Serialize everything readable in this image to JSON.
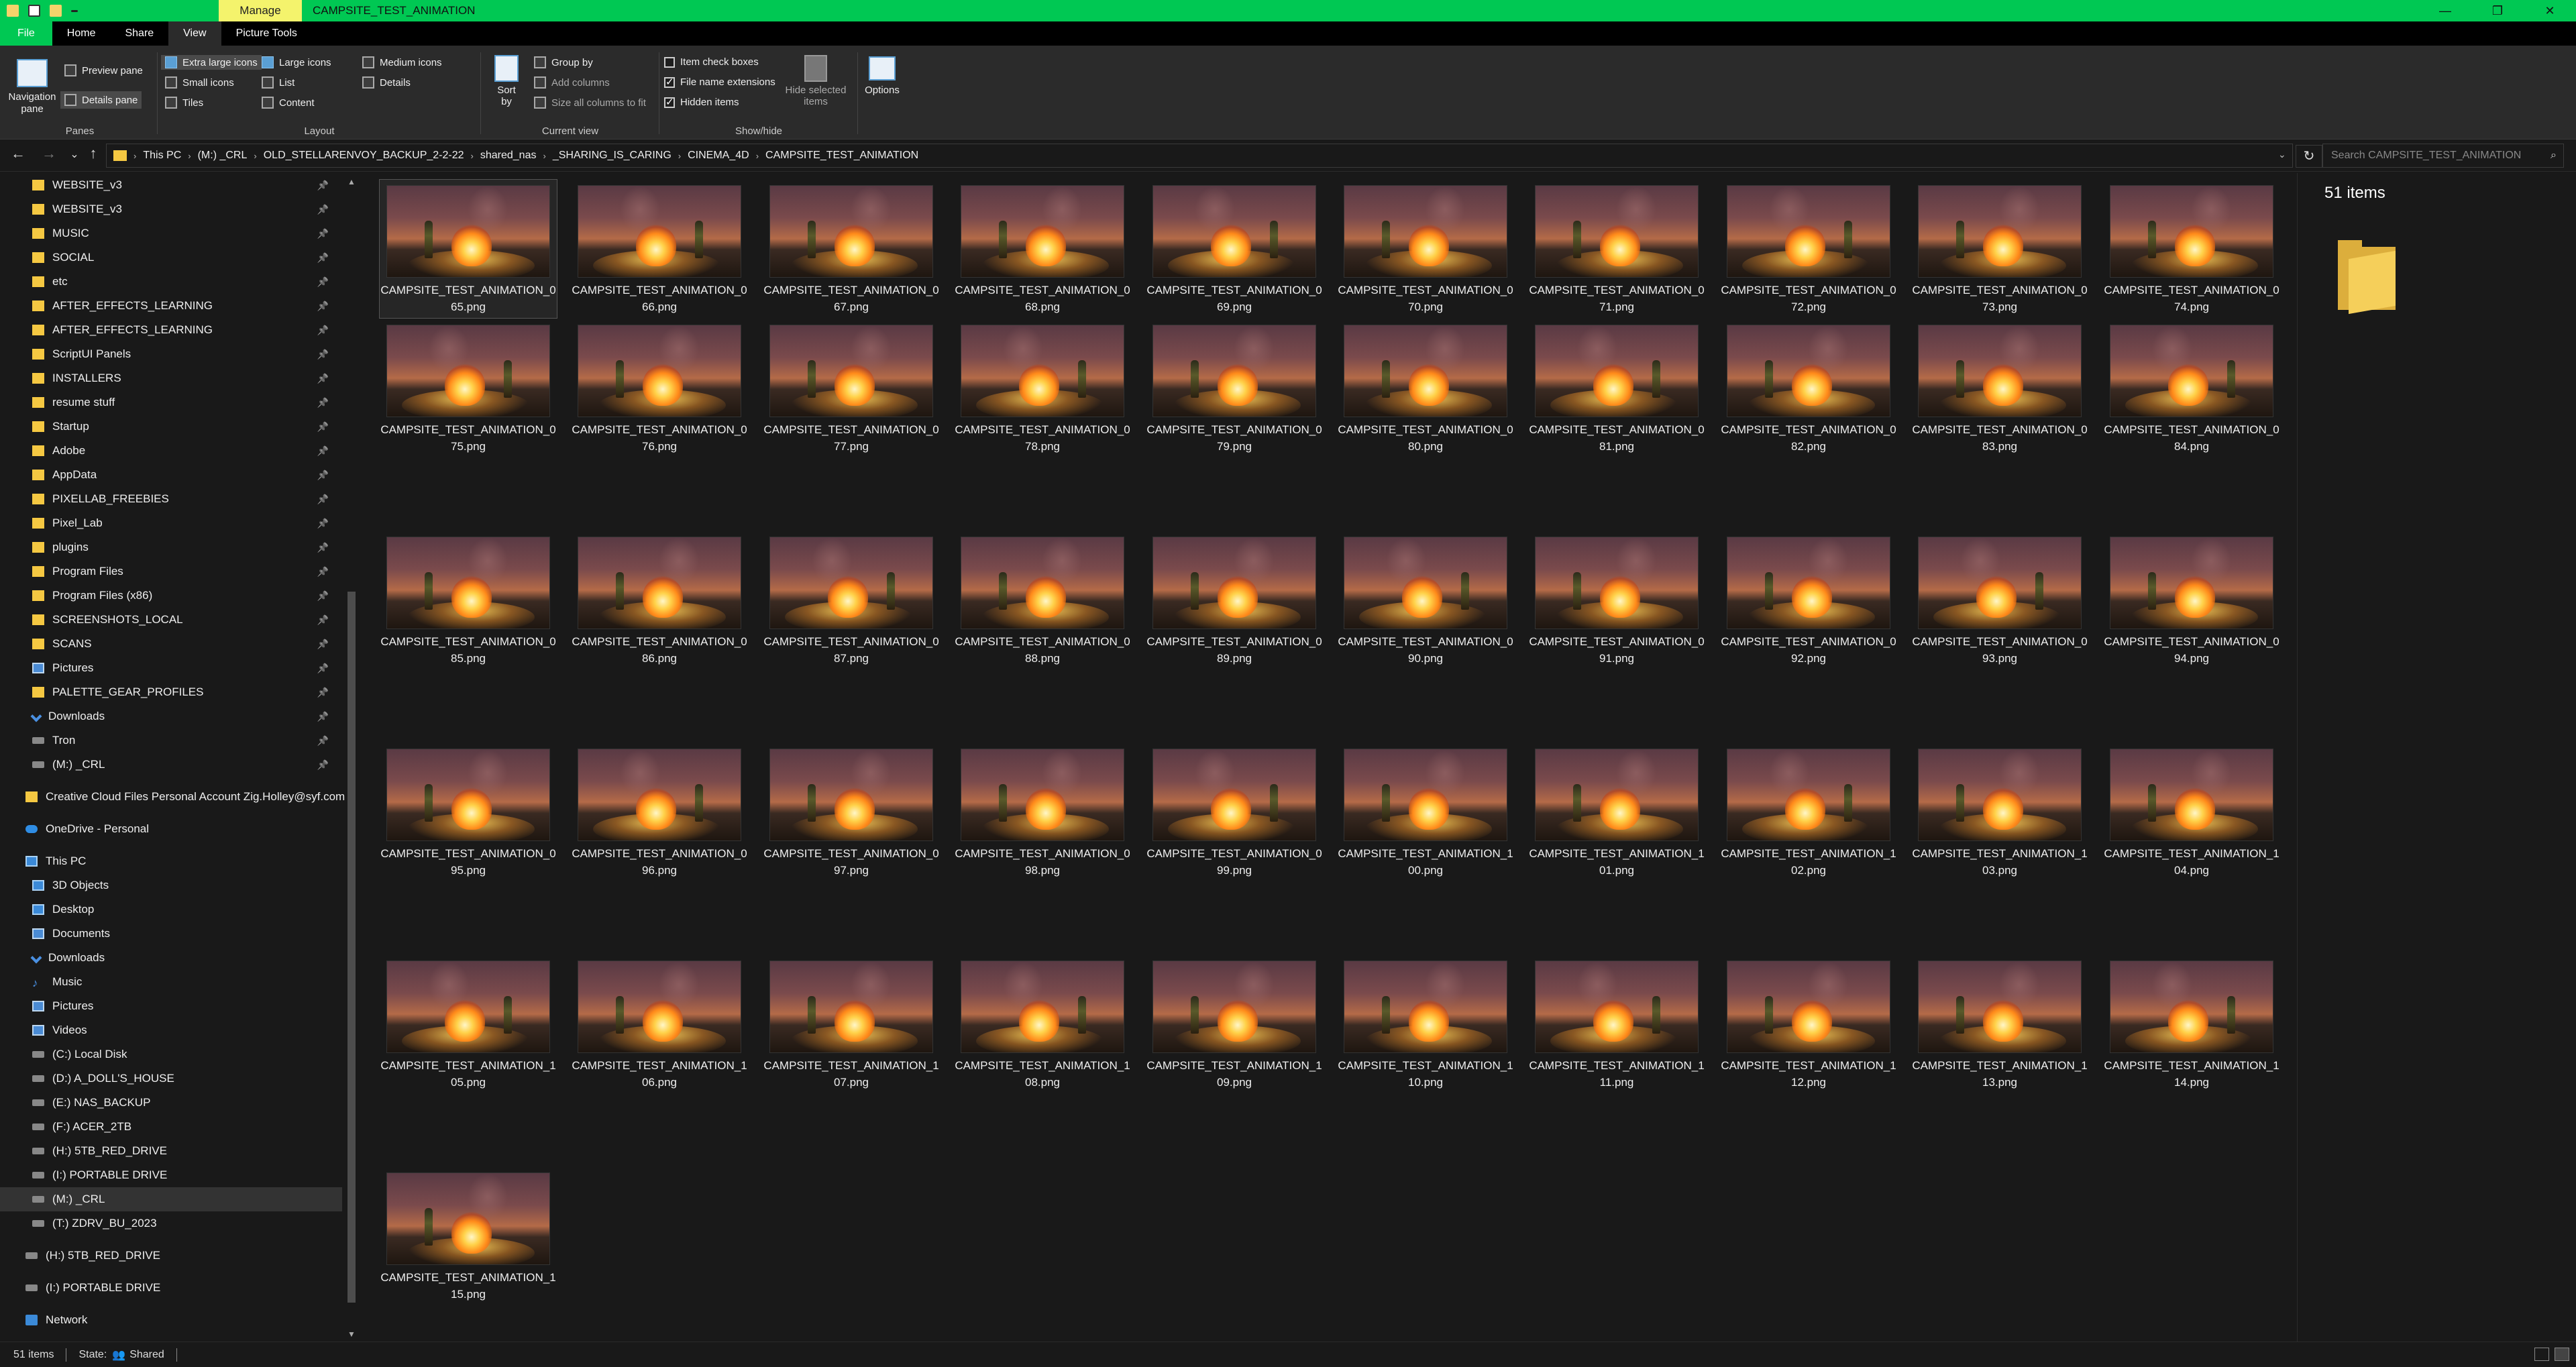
{
  "window": {
    "title": "CAMPSITE_TEST_ANIMATION",
    "context_tab": "Manage",
    "controls": [
      "—",
      "❐",
      "✕"
    ]
  },
  "ribbon_tabs": [
    "File",
    "Home",
    "Share",
    "View",
    "Picture Tools"
  ],
  "ribbon": {
    "panes": {
      "label": "Panes",
      "navigation_pane": "Navigation pane",
      "preview_pane": "Preview pane",
      "details_pane": "Details pane"
    },
    "layout": {
      "label": "Layout",
      "extra_large": "Extra large icons",
      "large": "Large icons",
      "medium": "Medium icons",
      "small": "Small icons",
      "list": "List",
      "details": "Details",
      "tiles": "Tiles",
      "content": "Content"
    },
    "current_view": {
      "label": "Current view",
      "sort_by": "Sort by",
      "group_by": "Group by",
      "add_columns": "Add columns",
      "size_columns": "Size all columns to fit"
    },
    "show_hide": {
      "label": "Show/hide",
      "item_check_boxes": "Item check boxes",
      "file_name_extensions": "File name extensions",
      "hidden_items": "Hidden items",
      "hide_selected": "Hide selected items",
      "checks": {
        "item_check_boxes": false,
        "file_name_extensions": true,
        "hidden_items": true
      }
    },
    "options": "Options"
  },
  "address": {
    "crumbs": [
      "This PC",
      "(M:) _CRL",
      "OLD_STELLARENVOY_BACKUP_2-2-22",
      "shared_nas",
      "_SHARING_IS_CARING",
      "CINEMA_4D",
      "CAMPSITE_TEST_ANIMATION"
    ],
    "search_placeholder": "Search CAMPSITE_TEST_ANIMATION"
  },
  "nav": {
    "quick_access": [
      {
        "label": "WEBSITE_v3",
        "icon": "folder",
        "pinned": true
      },
      {
        "label": "WEBSITE_v3",
        "icon": "folder",
        "pinned": true
      },
      {
        "label": "MUSIC",
        "icon": "folder",
        "pinned": true
      },
      {
        "label": "SOCIAL",
        "icon": "folder",
        "pinned": true
      },
      {
        "label": "etc",
        "icon": "folder",
        "pinned": true
      },
      {
        "label": "AFTER_EFFECTS_LEARNING",
        "icon": "folder",
        "pinned": true
      },
      {
        "label": "AFTER_EFFECTS_LEARNING",
        "icon": "folder",
        "pinned": true
      },
      {
        "label": "ScriptUI Panels",
        "icon": "folder",
        "pinned": true
      },
      {
        "label": "INSTALLERS",
        "icon": "folder",
        "pinned": true
      },
      {
        "label": "resume stuff",
        "icon": "folder",
        "pinned": true
      },
      {
        "label": "Startup",
        "icon": "folder",
        "pinned": true
      },
      {
        "label": "Adobe",
        "icon": "folder",
        "pinned": true
      },
      {
        "label": "AppData",
        "icon": "folder",
        "pinned": true
      },
      {
        "label": "PIXELLAB_FREEBIES",
        "icon": "folder",
        "pinned": true
      },
      {
        "label": "Pixel_Lab",
        "icon": "folder",
        "pinned": true
      },
      {
        "label": "plugins",
        "icon": "folder",
        "pinned": true
      },
      {
        "label": "Program Files",
        "icon": "folder",
        "pinned": true
      },
      {
        "label": "Program Files (x86)",
        "icon": "folder",
        "pinned": true
      },
      {
        "label": "SCREENSHOTS_LOCAL",
        "icon": "folder",
        "pinned": true
      },
      {
        "label": "SCANS",
        "icon": "folder",
        "pinned": true
      },
      {
        "label": "Pictures",
        "icon": "pic",
        "pinned": true
      },
      {
        "label": "PALETTE_GEAR_PROFILES",
        "icon": "folder",
        "pinned": true
      },
      {
        "label": "Downloads",
        "icon": "dl",
        "pinned": true
      },
      {
        "label": "Tron",
        "icon": "drive",
        "pinned": true
      },
      {
        "label": "(M:) _CRL",
        "icon": "drive",
        "pinned": true
      }
    ],
    "creative_cloud": "Creative Cloud Files Personal Account Zig.Holley@syf.com",
    "onedrive": "OneDrive - Personal",
    "this_pc": "This PC",
    "pc_items": [
      {
        "label": "3D Objects",
        "icon": "pc"
      },
      {
        "label": "Desktop",
        "icon": "pc"
      },
      {
        "label": "Documents",
        "icon": "pic"
      },
      {
        "label": "Downloads",
        "icon": "dl"
      },
      {
        "label": "Music",
        "icon": "music"
      },
      {
        "label": "Pictures",
        "icon": "pic"
      },
      {
        "label": "Videos",
        "icon": "pic"
      },
      {
        "label": "(C:) Local Disk",
        "icon": "drive"
      },
      {
        "label": "(D:) A_DOLL'S_HOUSE",
        "icon": "drive"
      },
      {
        "label": "(E:) NAS_BACKUP",
        "icon": "drive"
      },
      {
        "label": "(F:) ACER_2TB",
        "icon": "drive"
      },
      {
        "label": "(H:) 5TB_RED_DRIVE",
        "icon": "drive"
      },
      {
        "label": "(I:) PORTABLE DRIVE",
        "icon": "drive"
      },
      {
        "label": "(M:) _CRL",
        "icon": "drive",
        "selected": true
      },
      {
        "label": "(T:) ZDRV_BU_2023",
        "icon": "drive"
      }
    ],
    "extra_drives": [
      "(H:) 5TB_RED_DRIVE",
      "(I:) PORTABLE DRIVE"
    ],
    "network": "Network"
  },
  "files": [
    [
      "CAMPSITE_TEST_ANIMATION_0",
      "65.png"
    ],
    [
      "CAMPSITE_TEST_ANIMATION_0",
      "66.png"
    ],
    [
      "CAMPSITE_TEST_ANIMATION_0",
      "67.png"
    ],
    [
      "CAMPSITE_TEST_ANIMATION_0",
      "68.png"
    ],
    [
      "CAMPSITE_TEST_ANIMATION_0",
      "69.png"
    ],
    [
      "CAMPSITE_TEST_ANIMATION_0",
      "70.png"
    ],
    [
      "CAMPSITE_TEST_ANIMATION_0",
      "71.png"
    ],
    [
      "CAMPSITE_TEST_ANIMATION_0",
      "72.png"
    ],
    [
      "CAMPSITE_TEST_ANIMATION_0",
      "73.png"
    ],
    [
      "CAMPSITE_TEST_ANIMATION_0",
      "74.png"
    ],
    [
      "CAMPSITE_TEST_ANIMATION_0",
      "75.png"
    ],
    [
      "CAMPSITE_TEST_ANIMATION_0",
      "76.png"
    ],
    [
      "CAMPSITE_TEST_ANIMATION_0",
      "77.png"
    ],
    [
      "CAMPSITE_TEST_ANIMATION_0",
      "78.png"
    ],
    [
      "CAMPSITE_TEST_ANIMATION_0",
      "79.png"
    ],
    [
      "CAMPSITE_TEST_ANIMATION_0",
      "80.png"
    ],
    [
      "CAMPSITE_TEST_ANIMATION_0",
      "81.png"
    ],
    [
      "CAMPSITE_TEST_ANIMATION_0",
      "82.png"
    ],
    [
      "CAMPSITE_TEST_ANIMATION_0",
      "83.png"
    ],
    [
      "CAMPSITE_TEST_ANIMATION_0",
      "84.png"
    ],
    [
      "CAMPSITE_TEST_ANIMATION_0",
      "85.png"
    ],
    [
      "CAMPSITE_TEST_ANIMATION_0",
      "86.png"
    ],
    [
      "CAMPSITE_TEST_ANIMATION_0",
      "87.png"
    ],
    [
      "CAMPSITE_TEST_ANIMATION_0",
      "88.png"
    ],
    [
      "CAMPSITE_TEST_ANIMATION_0",
      "89.png"
    ],
    [
      "CAMPSITE_TEST_ANIMATION_0",
      "90.png"
    ],
    [
      "CAMPSITE_TEST_ANIMATION_0",
      "91.png"
    ],
    [
      "CAMPSITE_TEST_ANIMATION_0",
      "92.png"
    ],
    [
      "CAMPSITE_TEST_ANIMATION_0",
      "93.png"
    ],
    [
      "CAMPSITE_TEST_ANIMATION_0",
      "94.png"
    ],
    [
      "CAMPSITE_TEST_ANIMATION_0",
      "95.png"
    ],
    [
      "CAMPSITE_TEST_ANIMATION_0",
      "96.png"
    ],
    [
      "CAMPSITE_TEST_ANIMATION_0",
      "97.png"
    ],
    [
      "CAMPSITE_TEST_ANIMATION_0",
      "98.png"
    ],
    [
      "CAMPSITE_TEST_ANIMATION_0",
      "99.png"
    ],
    [
      "CAMPSITE_TEST_ANIMATION_1",
      "00.png"
    ],
    [
      "CAMPSITE_TEST_ANIMATION_1",
      "01.png"
    ],
    [
      "CAMPSITE_TEST_ANIMATION_1",
      "02.png"
    ],
    [
      "CAMPSITE_TEST_ANIMATION_1",
      "03.png"
    ],
    [
      "CAMPSITE_TEST_ANIMATION_1",
      "04.png"
    ],
    [
      "CAMPSITE_TEST_ANIMATION_1",
      "05.png"
    ],
    [
      "CAMPSITE_TEST_ANIMATION_1",
      "06.png"
    ],
    [
      "CAMPSITE_TEST_ANIMATION_1",
      "07.png"
    ],
    [
      "CAMPSITE_TEST_ANIMATION_1",
      "08.png"
    ],
    [
      "CAMPSITE_TEST_ANIMATION_1",
      "09.png"
    ],
    [
      "CAMPSITE_TEST_ANIMATION_1",
      "10.png"
    ],
    [
      "CAMPSITE_TEST_ANIMATION_1",
      "11.png"
    ],
    [
      "CAMPSITE_TEST_ANIMATION_1",
      "12.png"
    ],
    [
      "CAMPSITE_TEST_ANIMATION_1",
      "13.png"
    ],
    [
      "CAMPSITE_TEST_ANIMATION_1",
      "14.png"
    ],
    [
      "CAMPSITE_TEST_ANIMATION_1",
      "15.png"
    ]
  ],
  "details": {
    "item_count": "51 items"
  },
  "status": {
    "items": "51 items",
    "state": "State:",
    "shared": "Shared"
  },
  "colors": {
    "accent": "#00c853",
    "manage_tab": "#f4f36c",
    "background": "#191919",
    "ribbon": "#2b2b2b"
  }
}
